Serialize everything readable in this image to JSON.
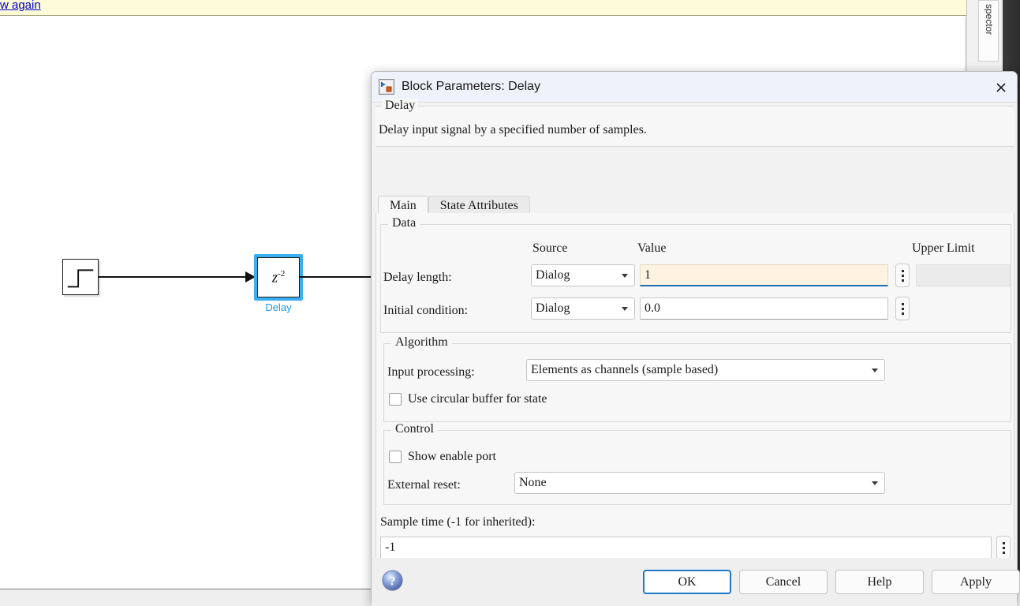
{
  "canvas": {
    "notification_link": "w again",
    "right_panel_tab": "spector",
    "blocks": [
      {
        "name": "step-block",
        "label": ""
      },
      {
        "name": "delay-block",
        "glyph": "z",
        "exponent": "-2",
        "caption": "Delay"
      }
    ]
  },
  "dialog": {
    "title": "Block Parameters: Delay",
    "icon": "simulink-block-icon",
    "close_icon": "close-icon",
    "description": {
      "legend": "Delay",
      "text": "Delay input signal by a specified number of samples."
    },
    "tabs": [
      {
        "label": "Main",
        "active": true
      },
      {
        "label": "State Attributes",
        "active": false
      }
    ],
    "data_group": {
      "legend": "Data",
      "column_headers": {
        "source": "Source",
        "value": "Value",
        "upper_limit": "Upper Limit"
      },
      "rows": [
        {
          "label": "Delay length:",
          "source": "Dialog",
          "value": "1",
          "upper_limit": "",
          "focused": true
        },
        {
          "label": "Initial condition:",
          "source": "Dialog",
          "value": "0.0",
          "upper_limit": null,
          "focused": false
        }
      ]
    },
    "algorithm_group": {
      "legend": "Algorithm",
      "input_processing_label": "Input processing:",
      "input_processing_value": "Elements as channels (sample based)",
      "circular_buffer_label": "Use circular buffer for state",
      "circular_buffer_checked": false
    },
    "control_group": {
      "legend": "Control",
      "show_enable_port_label": "Show enable port",
      "show_enable_port_checked": false,
      "external_reset_label": "External reset:",
      "external_reset_value": "None"
    },
    "sample_time": {
      "label": "Sample time (-1 for inherited):",
      "value": "-1"
    },
    "footer": {
      "help_icon": "help-sphere-icon",
      "ok": "OK",
      "cancel": "Cancel",
      "help": "Help",
      "apply": "Apply"
    }
  },
  "colors": {
    "accent_blue": "#1f78c8",
    "selection_blue": "#3ab0f3",
    "focus_field_bg": "#fdf3e0",
    "notification_bg": "#fdfbd8",
    "link_blue": "#0000cc"
  }
}
